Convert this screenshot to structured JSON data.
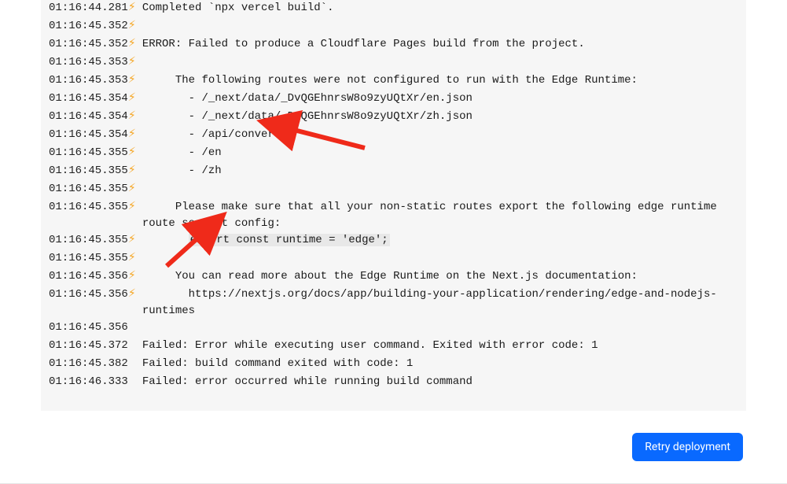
{
  "colors": {
    "panel_bg": "#f6f6f6",
    "lightning": "#f5a623",
    "arrow": "#ef2a1a",
    "highlight_bg": "#e8e8e8",
    "primary_btn": "#0969ff"
  },
  "log": [
    {
      "ts": "01:16:44.281",
      "bolt": true,
      "text": "Completed `npx vercel build`."
    },
    {
      "ts": "01:16:45.352",
      "bolt": true,
      "text": ""
    },
    {
      "ts": "01:16:45.352",
      "bolt": true,
      "text": "ERROR: Failed to produce a Cloudflare Pages build from the project."
    },
    {
      "ts": "01:16:45.353",
      "bolt": true,
      "text": ""
    },
    {
      "ts": "01:16:45.353",
      "bolt": true,
      "text": "     The following routes were not configured to run with the Edge Runtime:"
    },
    {
      "ts": "01:16:45.354",
      "bolt": true,
      "text": "       - /_next/data/_DvQGEhnrsW8o9zyUQtXr/en.json"
    },
    {
      "ts": "01:16:45.354",
      "bolt": true,
      "text": "       - /_next/data/_DvQGEhnrsW8o9zyUQtXr/zh.json"
    },
    {
      "ts": "01:16:45.354",
      "bolt": true,
      "text": "       - /api/convert"
    },
    {
      "ts": "01:16:45.355",
      "bolt": true,
      "text": "       - /en"
    },
    {
      "ts": "01:16:45.355",
      "bolt": true,
      "text": "       - /zh"
    },
    {
      "ts": "01:16:45.355",
      "bolt": true,
      "text": ""
    },
    {
      "ts": "01:16:45.355",
      "bolt": true,
      "text": "     Please make sure that all your non-static routes export the following edge runtime route segment config:"
    },
    {
      "ts": "01:16:45.355",
      "bolt": true,
      "text": "       ",
      "highlight": "export const runtime = 'edge';"
    },
    {
      "ts": "01:16:45.355",
      "bolt": true,
      "text": ""
    },
    {
      "ts": "01:16:45.356",
      "bolt": true,
      "text": "     You can read more about the Edge Runtime on the Next.js documentation:"
    },
    {
      "ts": "01:16:45.356",
      "bolt": true,
      "text": "       https://nextjs.org/docs/app/building-your-application/rendering/edge-and-nodejs-runtimes"
    },
    {
      "ts": "01:16:45.356",
      "bolt": false,
      "text": ""
    },
    {
      "ts": "01:16:45.372",
      "bolt": false,
      "text": "Failed: Error while executing user command. Exited with error code: 1"
    },
    {
      "ts": "01:16:45.382",
      "bolt": false,
      "text": "Failed: build command exited with code: 1"
    },
    {
      "ts": "01:16:46.333",
      "bolt": false,
      "text": "Failed: error occurred while running build command"
    }
  ],
  "annotations": {
    "arrow1_label": "points at /api/convert route",
    "arrow2_label": "points at export const runtime = 'edge';"
  },
  "actions": {
    "retry_label": "Retry deployment"
  }
}
